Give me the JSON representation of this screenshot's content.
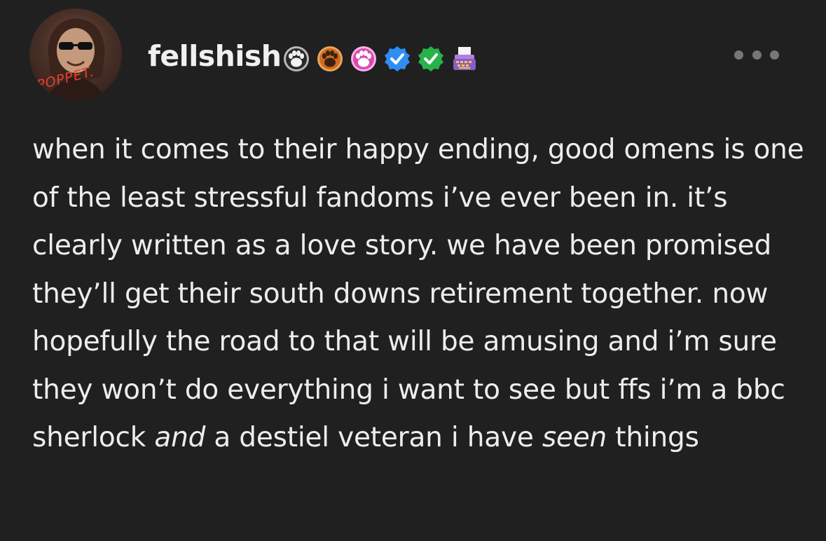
{
  "post": {
    "author": {
      "username": "fellshish",
      "avatar_text": "POPPET.",
      "avatar_icon": "person-with-sunglasses-avatar"
    },
    "badges": [
      {
        "icon": "paw-badge-black",
        "color": "#1c1c1c"
      },
      {
        "icon": "paw-badge-orange",
        "color": "#e07a2c"
      },
      {
        "icon": "paw-badge-pink",
        "color": "#e24fb4"
      },
      {
        "icon": "verified-check-badge-blue",
        "color": "#2f8ef4"
      },
      {
        "icon": "verified-check-badge-green",
        "color": "#27b24a"
      },
      {
        "icon": "typewriter-badge",
        "color": "#8a5cc8"
      }
    ],
    "menu_icon": "more-options-icon",
    "text": {
      "part1": "when it comes to their happy ending, good omens is one of the least stressful fandoms i’ve ever been in. it’s clearly written as a love story. we have been promised they’ll get their south downs retirement together. now hopefully the road to that will be amusing and i’m sure they won’t do everything i want to see but ffs i’m a bbc sherlock ",
      "emph1": "and",
      "part2": " a destiel veteran i have ",
      "emph2": "seen",
      "part3": " things"
    }
  }
}
